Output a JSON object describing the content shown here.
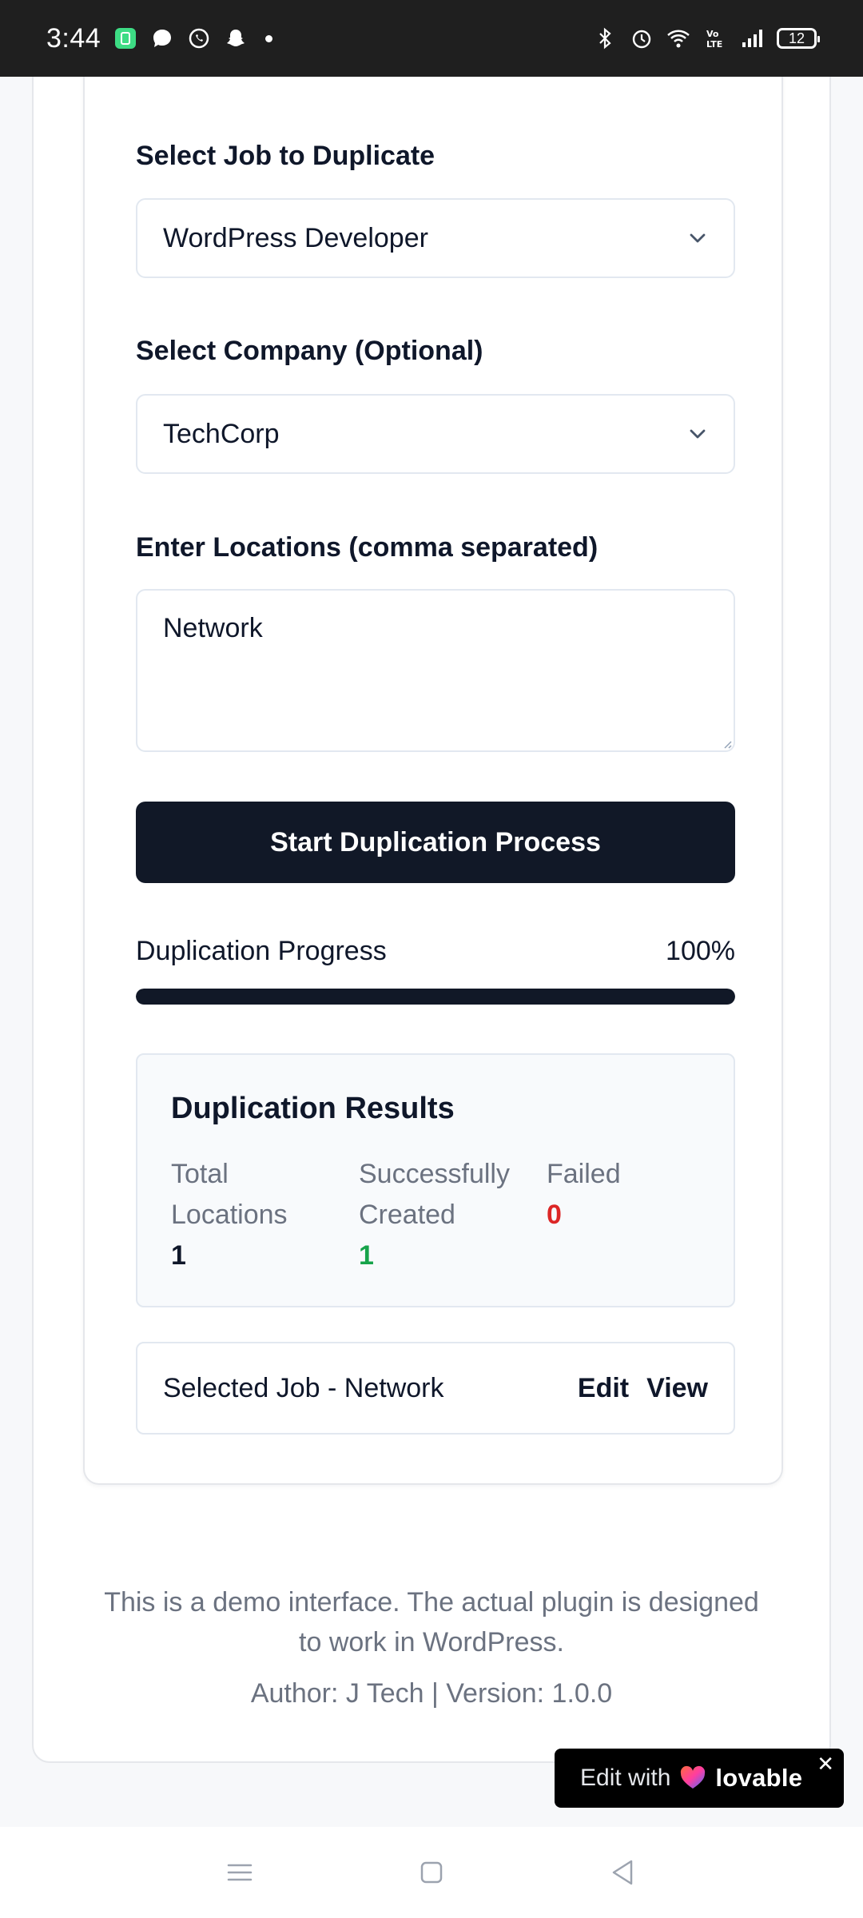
{
  "status_bar": {
    "time": "3:44",
    "battery": "12",
    "icons_left": [
      "app-notification-icon",
      "chat-icon",
      "whatsapp-icon",
      "snapchat-icon"
    ],
    "icons_right": [
      "bluetooth-icon",
      "alarm-icon",
      "wifi-icon",
      "volte-icon",
      "signal-icon",
      "battery-icon"
    ]
  },
  "form": {
    "job_label": "Select Job to Duplicate",
    "job_value": "WordPress Developer",
    "company_label": "Select Company (Optional)",
    "company_value": "TechCorp",
    "locations_label": "Enter Locations (comma separated)",
    "locations_value": "Network",
    "start_button": "Start Duplication Process"
  },
  "progress": {
    "label": "Duplication Progress",
    "percent_text": "100%",
    "percent": 100
  },
  "results": {
    "title": "Duplication Results",
    "total_label_1": "Total",
    "total_label_2": "Locations",
    "total_value": "1",
    "success_label_1": "Successfully",
    "success_label_2": "Created",
    "success_value": "1",
    "failed_label": "Failed",
    "failed_value": "0"
  },
  "job_row": {
    "title": "Selected Job - Network",
    "edit": "Edit",
    "view": "View"
  },
  "footer": {
    "line1": "This is a demo interface. The actual plugin is designed",
    "line2": "to work in WordPress.",
    "author": "Author: J Tech | Version: 1.0.0"
  },
  "badge": {
    "edit_with": "Edit with",
    "brand": "lovable",
    "close": "✕"
  },
  "colors": {
    "primary": "#111827",
    "success": "#16a34a",
    "danger": "#dc2626",
    "muted": "#6b7280"
  }
}
